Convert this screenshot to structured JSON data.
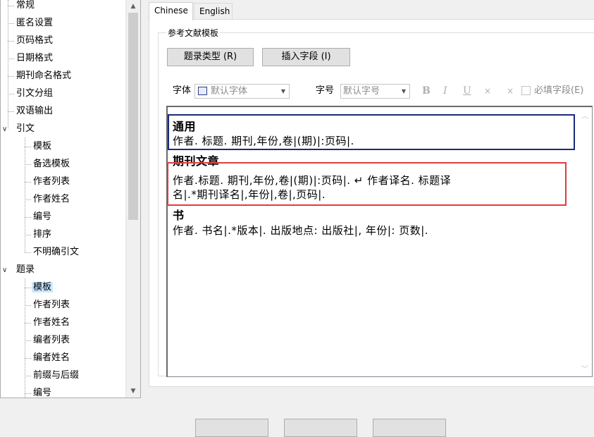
{
  "tree": {
    "items": [
      {
        "label": "常规",
        "level": 0
      },
      {
        "label": "匿名设置",
        "level": 0
      },
      {
        "label": "页码格式",
        "level": 0
      },
      {
        "label": "日期格式",
        "level": 0
      },
      {
        "label": "期刊命名格式",
        "level": 0
      },
      {
        "label": "引文分组",
        "level": 0
      },
      {
        "label": "双语输出",
        "level": 0
      },
      {
        "label": "引文",
        "level": 0,
        "expanded": true
      },
      {
        "label": "模板",
        "level": 1
      },
      {
        "label": "备选模板",
        "level": 1
      },
      {
        "label": "作者列表",
        "level": 1
      },
      {
        "label": "作者姓名",
        "level": 1
      },
      {
        "label": "编号",
        "level": 1
      },
      {
        "label": "排序",
        "level": 1
      },
      {
        "label": "不明确引文",
        "level": 1
      },
      {
        "label": "题录",
        "level": 0,
        "expanded": true
      },
      {
        "label": "模板",
        "level": 1,
        "selected": true
      },
      {
        "label": "作者列表",
        "level": 1
      },
      {
        "label": "作者姓名",
        "level": 1
      },
      {
        "label": "编者列表",
        "level": 1
      },
      {
        "label": "编者姓名",
        "level": 1
      },
      {
        "label": "前缀与后缀",
        "level": 1
      },
      {
        "label": "编号",
        "level": 1
      }
    ]
  },
  "tabs": [
    {
      "label": "Chinese",
      "active": true
    },
    {
      "label": "English",
      "active": false
    }
  ],
  "group_title": "参考文献模板",
  "buttons": {
    "ref_type": "题录类型 (R)",
    "insert_field": "插入字段 (I)"
  },
  "toolbar": {
    "font_label": "字体",
    "font_value": "默认字体",
    "size_label": "字号",
    "size_value": "默认字号",
    "bold": "B",
    "italic": "I",
    "underline": "U",
    "superscript": "×",
    "subscript": "×",
    "required_field_label": "必填字段(E)"
  },
  "editor": {
    "sections": [
      {
        "heading": "通用",
        "lines": [
          "作者. 标题. 期刊,年份,卷|(期)|:页码|."
        ]
      },
      {
        "heading": "期刊文章",
        "lines": [
          "作者.标题. 期刊,年份,卷|(期)|:页码|.  ↵ 作者译名. 标题译",
          "名|.*期刊译名|,年份|,卷|,页码|."
        ]
      },
      {
        "heading": "书",
        "lines": [
          "作者. 书名|.*版本|. 出版地点: 出版社|, 年份|: 页数|."
        ]
      }
    ]
  },
  "colors": {
    "highlight_blue_box": "#1a2a7a",
    "highlight_red_box": "#e03c3c",
    "tree_selected": "#cce8ff"
  }
}
